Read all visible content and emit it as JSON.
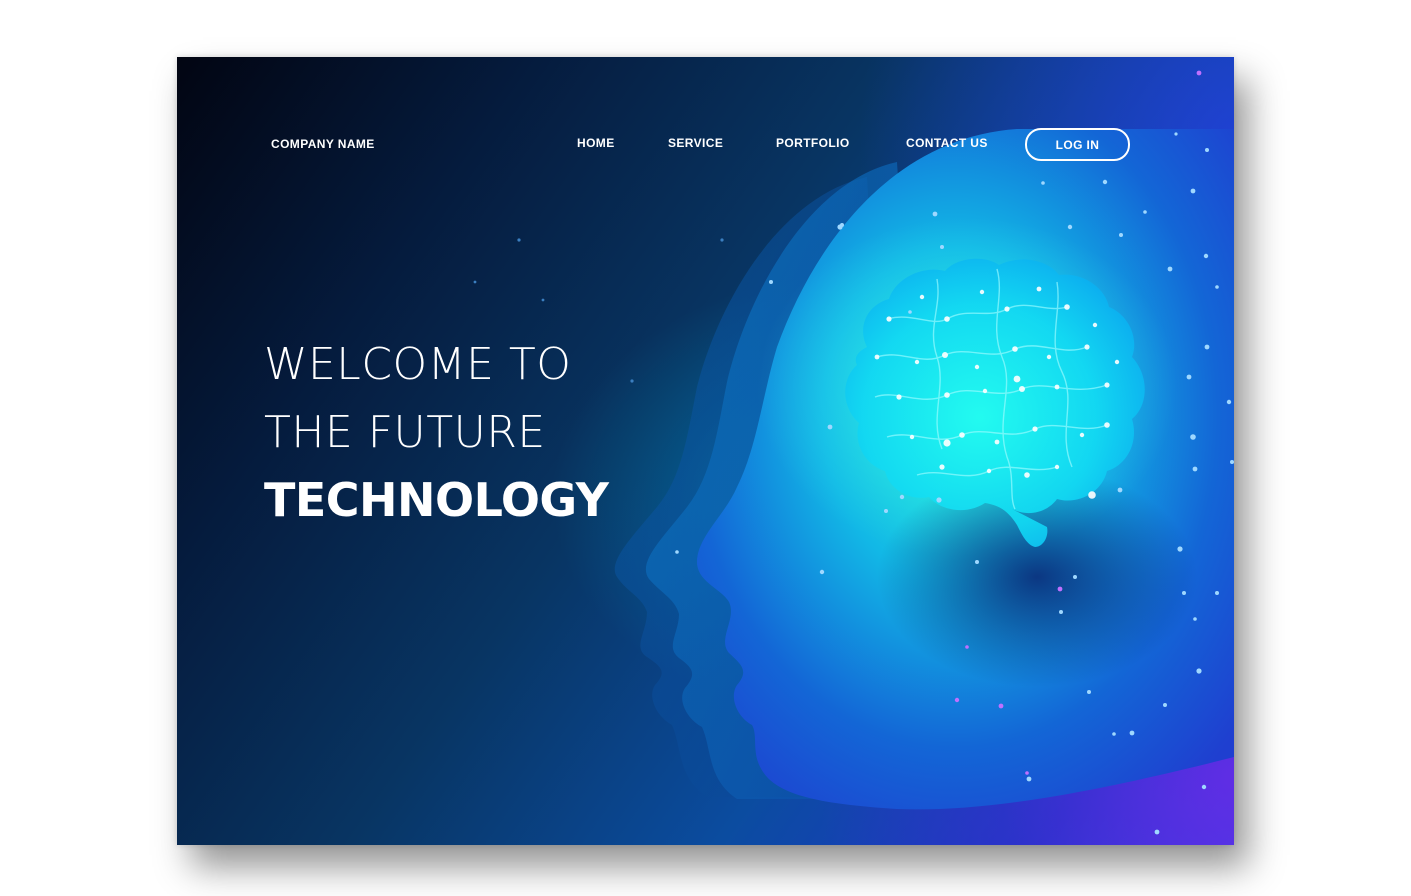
{
  "header": {
    "company_name": "COMPANY NAME",
    "nav": [
      {
        "label": "HOME"
      },
      {
        "label": "SERVICE"
      },
      {
        "label": "PORTFOLIO"
      },
      {
        "label": "CONTACT US"
      }
    ],
    "login_label": "LOG IN"
  },
  "hero": {
    "line1": "WELCOME TO",
    "line2": "THE FUTURE",
    "line3": "TECHNOLOGY"
  },
  "colors": {
    "text": "#ffffff",
    "brain_glow": "#1ee8f0",
    "background_dark": "#020512",
    "background_blue": "#1f37c9",
    "accent_purple": "#6e28e6"
  },
  "icons": [
    "head-silhouette-icon",
    "brain-icon"
  ]
}
